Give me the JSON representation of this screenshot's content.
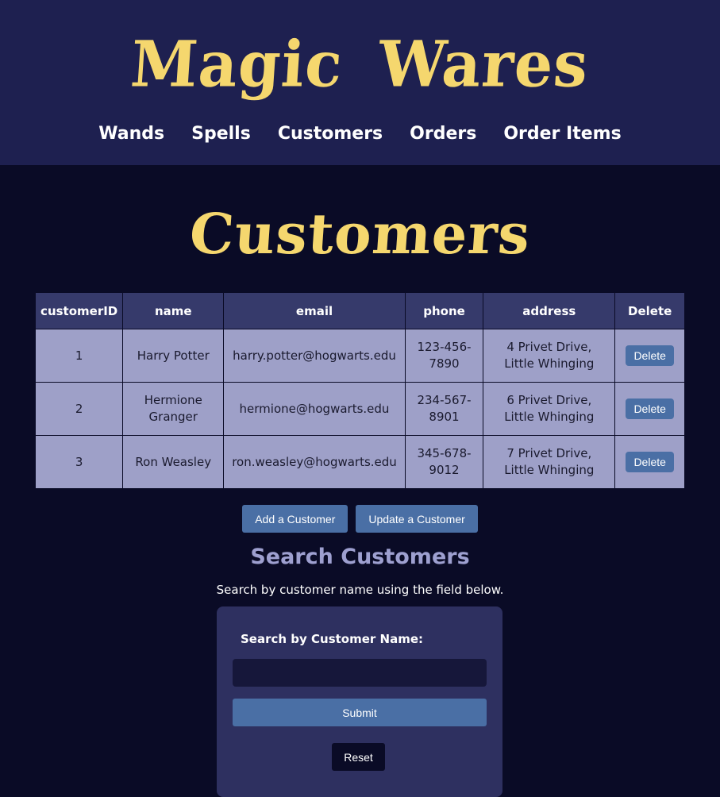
{
  "header": {
    "logo_text": "Magic Wares",
    "nav": [
      {
        "label": "Wands"
      },
      {
        "label": "Spells"
      },
      {
        "label": "Customers"
      },
      {
        "label": "Orders"
      },
      {
        "label": "Order Items"
      }
    ]
  },
  "page": {
    "title": "Customers"
  },
  "table": {
    "columns": [
      "customerID",
      "name",
      "email",
      "phone",
      "address",
      "Delete"
    ],
    "rows": [
      {
        "customerID": "1",
        "name": "Harry Potter",
        "email": "harry.potter@hogwarts.edu",
        "phone": "123-456-7890",
        "address": "4 Privet Drive, Little Whinging",
        "delete_label": "Delete"
      },
      {
        "customerID": "2",
        "name": "Hermione Granger",
        "email": "hermione@hogwarts.edu",
        "phone": "234-567-8901",
        "address": "6 Privet Drive, Little Whinging",
        "delete_label": "Delete"
      },
      {
        "customerID": "3",
        "name": "Ron Weasley",
        "email": "ron.weasley@hogwarts.edu",
        "phone": "345-678-9012",
        "address": "7 Privet Drive, Little Whinging",
        "delete_label": "Delete"
      }
    ]
  },
  "actions": {
    "add_label": "Add a Customer",
    "update_label": "Update a Customer"
  },
  "search": {
    "title": "Search Customers",
    "subtitle": "Search by customer name using the field below.",
    "field_label": "Search by Customer Name:",
    "input_value": "",
    "submit_label": "Submit",
    "reset_label": "Reset"
  },
  "colors": {
    "header_bg": "#1e2050",
    "page_bg": "#0a0b26",
    "gold": "#f5d76e",
    "table_header": "#363a6b",
    "table_cell": "#9ea0c8",
    "button": "#4a6fa5"
  }
}
